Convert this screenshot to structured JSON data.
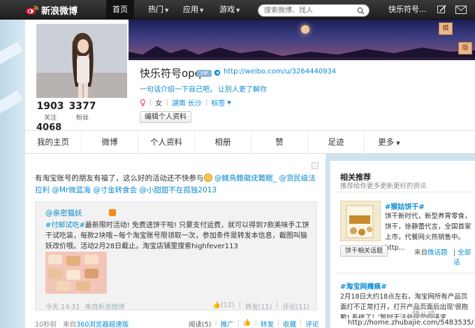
{
  "nav": {
    "logo_text": "新浪微博",
    "home": "首页",
    "items": [
      {
        "label": "热门"
      },
      {
        "label": "应用"
      },
      {
        "label": "游戏"
      }
    ],
    "search_placeholder": "搜索微博、找人",
    "user_name": "快乐符号..."
  },
  "profile": {
    "username": "快乐符号opq",
    "vip_badge": "VIP",
    "weibo_url": "http://weibo.com/u/3264440934",
    "intro_link1": "一句话介绍一下自己吧，",
    "intro_link2": "让别人更了解你",
    "gender": "女",
    "location": "湖南 长沙",
    "tags_label": "标签",
    "edit_button": "编辑个人资料",
    "stats": {
      "follow_count": "1903",
      "follow_label": "关注",
      "fans_count": "3377",
      "fans_label": "粉丝",
      "weibo_count": "4068"
    }
  },
  "tabs": [
    {
      "label": "我的主页"
    },
    {
      "label": "微博"
    },
    {
      "label": "个人资料"
    },
    {
      "label": "相册"
    },
    {
      "label": "赞"
    },
    {
      "label": "足迹"
    },
    {
      "label": "更多"
    }
  ],
  "feed": {
    "text_before": "有淘宝账号的朋友有福了，这么好的活动还不快参与",
    "mention1": "@雠鳥雔徽疣難眠_",
    "mention2": "@货民级法拉利",
    "mention3": "@Mr微蓝海",
    "mention4": "@寸金转食会",
    "mention5": "@小甜甜不在孤独2013",
    "repost": {
      "author": "@亲密猫妖",
      "hashtag": "#付邮试吃#",
      "text": "最新限时活动! 免费送饼干啦! 只要支付运费，就可以得到7款美味手工饼干试吃装，每款2块哦~每个淘宝账号限领取一次，参加条件是转发本信息，截图叫猫妖改价哦。活动2月28日截止。淘宝店铺里搜索highfever113",
      "time": "今天 14:31",
      "from_label": "来自",
      "source": "新浪微博",
      "likes": "(12)",
      "reposts": "转发(11)",
      "comments": "评论(11)"
    },
    "time": "10秒前",
    "from_label": "来自",
    "source": "360浏览器超速版",
    "reads": "阅读(5)",
    "promote": "推广",
    "repost_btn": "转发",
    "fav_btn": "收藏",
    "comment_btn": "评论"
  },
  "sidebar": {
    "title": "相关推荐",
    "subtitle": "推荐给你更多更新更好的资讯",
    "rec1": {
      "title": "#猴姑饼干#",
      "desc": "饼干新时代，新型养胃零食，饼干，徐静蕾代言，全国首家上市，代餐网火热销售中。http...",
      "tag_button": "饼干相关话题",
      "src_prefix": "来自",
      "src": "微话题",
      "all": "全部话"
    },
    "rec2": {
      "title": "#淘宝网瘫痪#",
      "desc": "2月18日大约18点左右，淘宝网所有产品页面打不正常打开，打开产品页面后出现'很抱歉! 系统了！'暂时无法处理您的请求..."
    }
  },
  "status_url": "http://home.zhubajie.com/5483535/",
  "watermark": "猪八戒"
}
